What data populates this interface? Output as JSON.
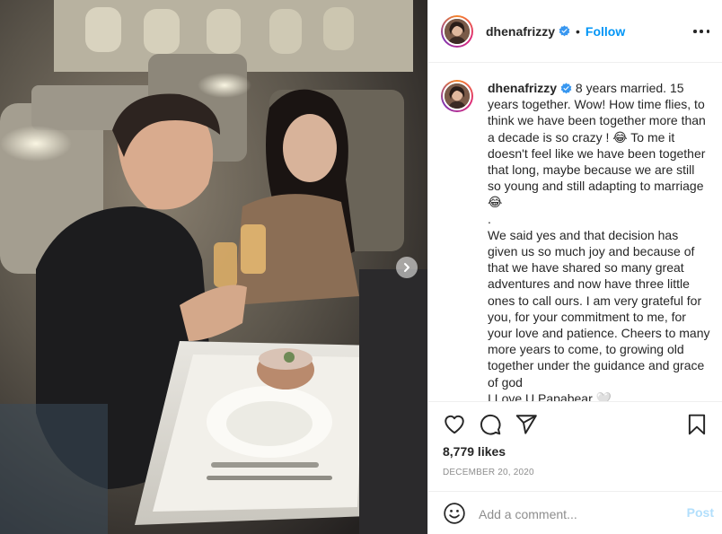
{
  "post": {
    "username": "dhenafrizzy",
    "follow_label": "Follow",
    "separator": "•",
    "caption_username": "dhenafrizzy",
    "caption_text": " 8 years married. 15 years together. Wow! How time flies, to think we have been together more than a decade is so crazy ! 😂 To me it doesn't feel like we have been together that long, maybe because we are still so young and still adapting to marriage 😂\n.\nWe said yes and that decision has given us so much joy and because of that we have shared so many great adventures and now have three little ones to call ours. I am very grateful for you, for your commitment to me, for your love and patience. Cheers to many more years to come, to growing old together under the guidance and grace of god\nI Love U Papabear 🤍",
    "likes": "8,779 likes",
    "date": "DECEMBER 20, 2020"
  },
  "comment": {
    "placeholder": "Add a comment...",
    "post_label": "Post"
  },
  "icons": {
    "verified": "verified-badge-icon",
    "more": "more-options-icon",
    "like": "heart-icon",
    "comment": "comment-icon",
    "share": "paper-plane-icon",
    "save": "bookmark-icon",
    "emoji": "smiley-icon",
    "carousel_next": "chevron-right-icon"
  },
  "colors": {
    "accent": "#0095f6",
    "post_disabled": "#b2dffc",
    "muted": "#8e8e8e",
    "text": "#262626",
    "border": "#efefef"
  }
}
